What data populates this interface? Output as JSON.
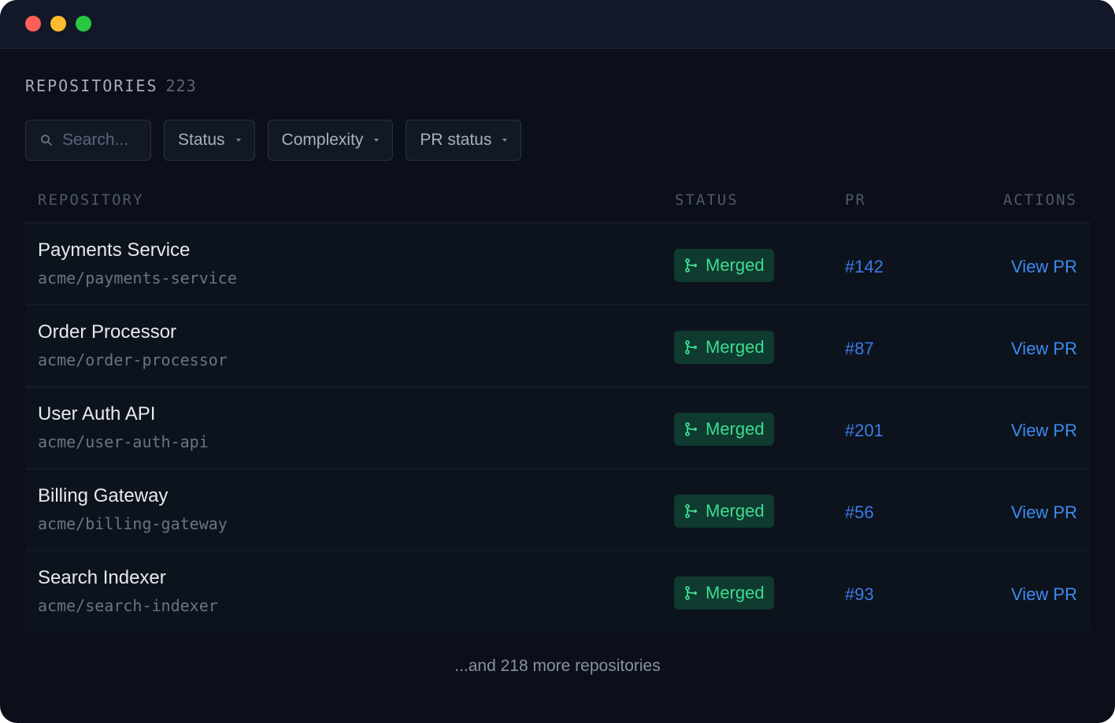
{
  "header": {
    "title": "REPOSITORIES",
    "count": "223"
  },
  "filters": {
    "search_placeholder": "Search...",
    "status_label": "Status",
    "complexity_label": "Complexity",
    "pr_status_label": "PR status"
  },
  "table": {
    "columns": [
      "REPOSITORY",
      "STATUS",
      "PR",
      "ACTIONS"
    ],
    "rows": [
      {
        "name": "Payments Service",
        "path": "acme/payments-service",
        "status": "Merged",
        "pr": "#142",
        "action": "View PR"
      },
      {
        "name": "Order Processor",
        "path": "acme/order-processor",
        "status": "Merged",
        "pr": "#87",
        "action": "View PR"
      },
      {
        "name": "User Auth API",
        "path": "acme/user-auth-api",
        "status": "Merged",
        "pr": "#201",
        "action": "View PR"
      },
      {
        "name": "Billing Gateway",
        "path": "acme/billing-gateway",
        "status": "Merged",
        "pr": "#56",
        "action": "View PR"
      },
      {
        "name": "Search Indexer",
        "path": "acme/search-indexer",
        "status": "Merged",
        "pr": "#93",
        "action": "View PR"
      }
    ]
  },
  "footer": {
    "more_text": "...and 218 more repositories"
  },
  "colors": {
    "background": "#0b0f19",
    "accent_green": "#3ddc8f",
    "link_blue": "#3b8bf0"
  },
  "icons": {
    "search": "search-icon",
    "caret": "chevron-down-icon",
    "merge": "git-merge-icon"
  }
}
